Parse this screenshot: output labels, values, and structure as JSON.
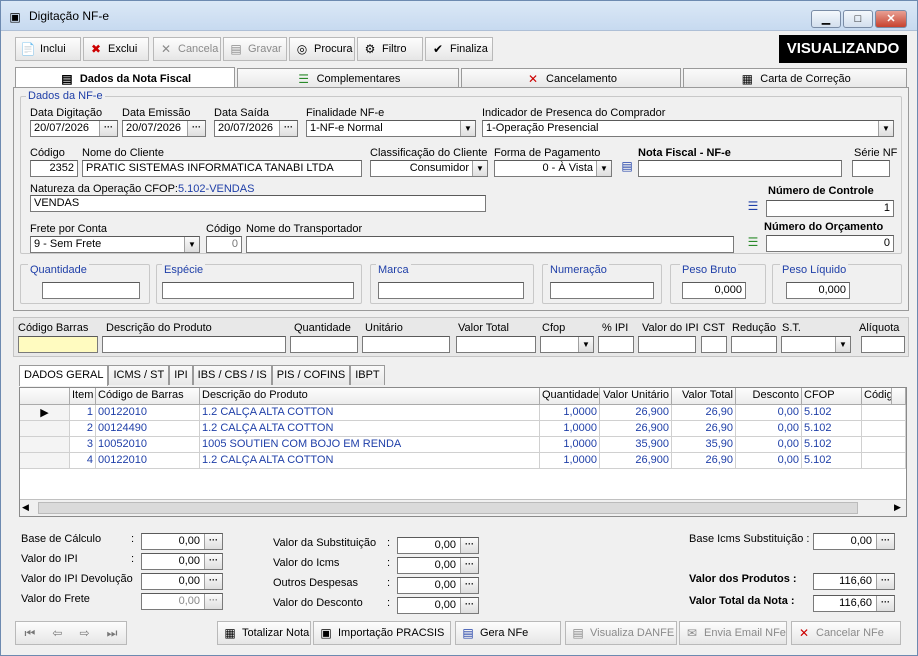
{
  "window": {
    "title": "Digitação NF-e",
    "min": "▁",
    "max": "□",
    "close": "✕"
  },
  "toolbar": {
    "inclui": "Inclui",
    "exclui": "Exclui",
    "cancela": "Cancela",
    "gravar": "Gravar",
    "procura": "Procura",
    "filtro": "Filtro",
    "finaliza": "Finaliza",
    "status": "VISUALIZANDO"
  },
  "tabs": [
    "Dados da Nota Fiscal",
    "Complementares",
    "Cancelamento",
    "Carta de Correção"
  ],
  "nfe": {
    "group": "Dados da NF-e",
    "data_digitacao_label": "Data Digitação",
    "data_digitacao": "20/07/2026",
    "data_emissao_label": "Data Emissão",
    "data_emissao": "20/07/2026",
    "data_saida_label": "Data Saída",
    "data_saida": "20/07/2026",
    "finalidade_label": "Finalidade NF-e",
    "finalidade": "1-NF-e Normal",
    "indicador_label": "Indicador de Presenca do Comprador",
    "indicador": "1-Operação Presencial",
    "codigo_label": "Código",
    "codigo": "2352",
    "cliente_label": "Nome do Cliente",
    "cliente": "PRATIC SISTEMAS INFORMATICA TANABI LTDA",
    "classif_label": "Classificação do Cliente",
    "classif": "Consumidor",
    "forma_label": "Forma de Pagamento",
    "forma": "0 - À Vista",
    "nota_label": "Nota Fiscal - NF-e",
    "nota": "",
    "serie_label": "Série NF",
    "serie": "",
    "natureza_label": "Natureza da Operação CFOP:",
    "natureza_cfop": "5.102-VENDAS",
    "natureza": "VENDAS",
    "controle_label": "Número de Controle",
    "controle": "1",
    "orcamento_label": "Número do Orçamento",
    "orcamento": "0",
    "frete_label": "Frete por Conta",
    "frete": "9 - Sem Frete",
    "transp_cod_label": "Código",
    "transp_cod": "0",
    "transp_label": "Nome do Transportador",
    "transp": "",
    "quantidade_label": "Quantidade",
    "especie_label": "Espécie",
    "marca_label": "Marca",
    "numeracao_label": "Numeração",
    "peso_bruto_label": "Peso Bruto",
    "peso_bruto": "0,000",
    "peso_liq_label": "Peso Líquido",
    "peso_liq": "0,000"
  },
  "entry": {
    "cols": [
      "Código Barras",
      "Descrição do Produto",
      "Quantidade",
      "Unitário",
      "Valor Total",
      "Cfop",
      "% IPI",
      "Valor do IPI",
      "CST",
      "Redução",
      "S.T.",
      "Alíquota"
    ]
  },
  "subtabs": [
    "DADOS GERAL",
    "ICMS / ST",
    "IPI",
    "IBS / CBS / IS",
    "PIS / COFINS",
    "IBPT"
  ],
  "grid": {
    "headers": [
      "Item",
      "Código de Barras",
      "Descrição do Produto",
      "Quantidade",
      "Valor Unitário",
      "Valor Total",
      "Desconto",
      "CFOP",
      "Código C"
    ],
    "rows": [
      [
        "1",
        "00122010",
        "1.2 CALÇA ALTA COTTON",
        "1,0000",
        "26,900",
        "26,90",
        "0,00",
        "5.102"
      ],
      [
        "2",
        "00124490",
        "1.2 CALÇA ALTA COTTON",
        "1,0000",
        "26,900",
        "26,90",
        "0,00",
        "5.102"
      ],
      [
        "3",
        "10052010",
        "1005 SOUTIEN COM BOJO EM RENDA",
        "1,0000",
        "35,900",
        "35,90",
        "0,00",
        "5.102"
      ],
      [
        "4",
        "00122010",
        "1.2 CALÇA ALTA COTTON",
        "1,0000",
        "26,900",
        "26,90",
        "0,00",
        "5.102"
      ]
    ]
  },
  "totals": {
    "base_calc_label": "Base de Cálculo",
    "base_calc": "0,00",
    "ipi_label": "Valor do IPI",
    "ipi": "0,00",
    "ipi_dev_label": "Valor do IPI Devolução",
    "ipi_dev": "0,00",
    "frete_label": "Valor do Frete",
    "frete": "0,00",
    "subst_label": "Valor da Substituição",
    "subst": "0,00",
    "icms_label": "Valor do Icms",
    "icms": "0,00",
    "outras_label": "Outros Despesas",
    "outras": "0,00",
    "desc_label": "Valor do Desconto",
    "desc": "0,00",
    "base_st_label": "Base Icms Substituição :",
    "base_st": "0,00",
    "produtos_label": "Valor dos Produtos :",
    "produtos": "116,60",
    "total_label": "Valor Total da Nota  :",
    "total": "116,60"
  },
  "bottom": {
    "totalizar": "Totalizar Nota",
    "importacao": "Importação PRACSIS",
    "gera": "Gera NFe",
    "danfe": "Visualiza DANFE",
    "email": "Envia Email NFe",
    "cancelar": "Cancelar NFe"
  }
}
